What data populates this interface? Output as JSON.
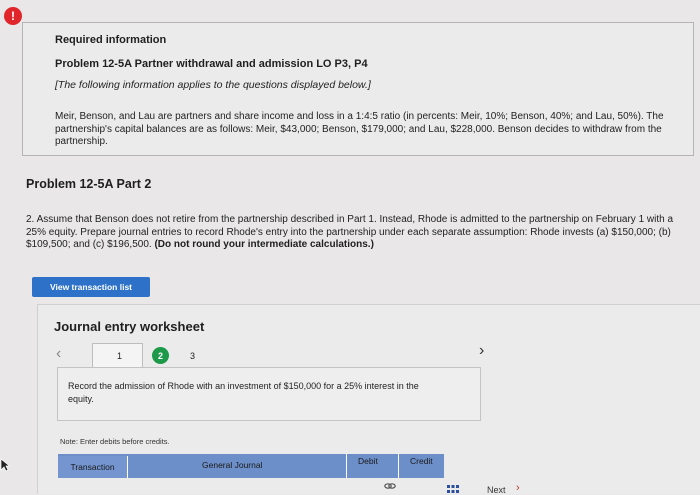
{
  "alert": {
    "symbol": "!"
  },
  "info": {
    "title": "Required information",
    "problem": "Problem 12-5A Partner withdrawal and admission LO P3, P4",
    "note": "[The following information applies to the questions displayed below.]",
    "body": "Meir, Benson, and Lau are partners and share income and loss in a 1:4:5 ratio (in percents: Meir, 10%; Benson, 40%; and Lau, 50%). The partnership's capital balances are as follows: Meir, $43,000; Benson, $179,000; and Lau, $228,000. Benson decides to withdraw from the partnership."
  },
  "part": {
    "heading": "Problem 12-5A Part 2",
    "question": "2. Assume that Benson does not retire from the partnership described in Part 1. Instead, Rhode is admitted to the partnership on February 1 with a 25% equity. Prepare journal entries to record Rhode's entry into the partnership under each separate assumption: Rhode invests (a) $150,000; (b) $109,500; and (c) $196,500.",
    "question_bold": "(Do not round your intermediate calculations.)"
  },
  "buttons": {
    "view_transactions": "View transaction list"
  },
  "journal": {
    "title": "Journal entry worksheet",
    "steps": [
      "1",
      "2",
      "3"
    ],
    "prompt": "Record the admission of Rhode with an investment of $150,000 for a 25% interest in the equity.",
    "note": "Note: Enter debits before credits.",
    "columns": {
      "transaction": "Transaction",
      "general_journal": "General Journal",
      "debit": "Debit",
      "credit": "Credit"
    },
    "next": "Next"
  },
  "icons": {
    "prev": "chevron-left-icon",
    "next": "chevron-right-icon",
    "link": "link-icon",
    "grid": "grid-icon"
  },
  "colors": {
    "accent": "#2d72c8",
    "table_header": "#6d8fc9",
    "active_step": "#1c9a4a",
    "alert": "#e0262a"
  }
}
